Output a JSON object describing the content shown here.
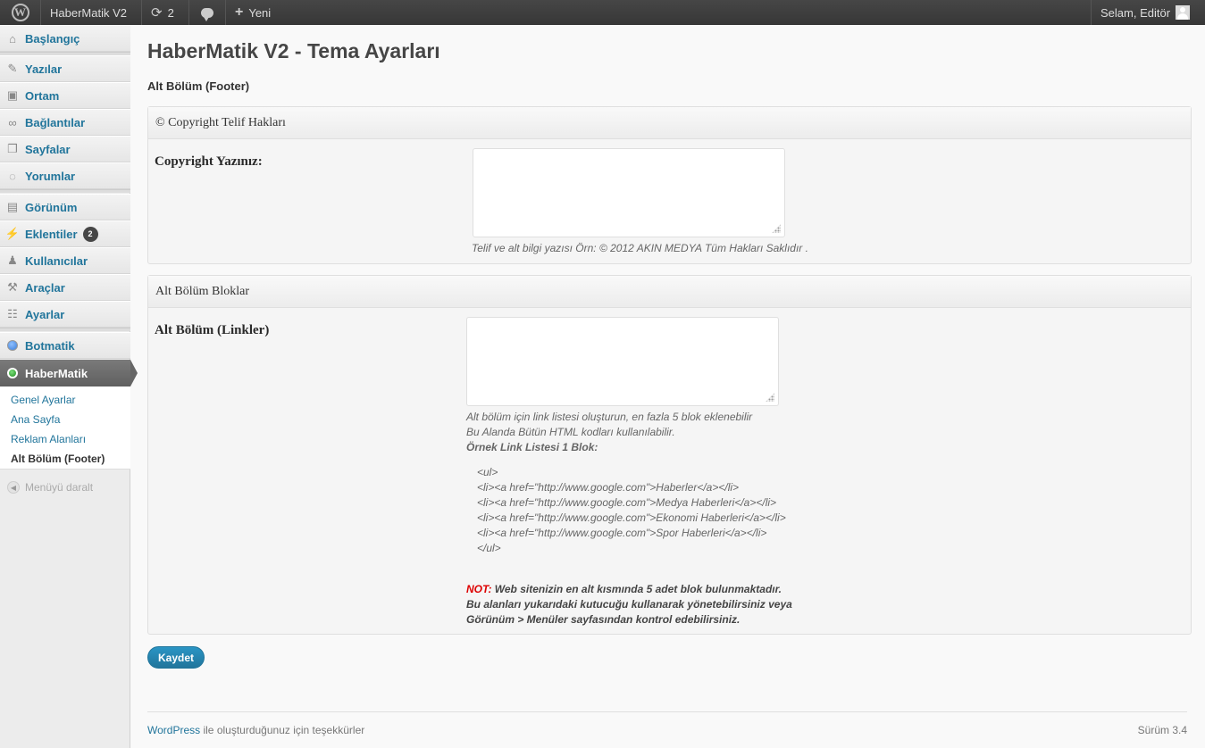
{
  "adminbar": {
    "site_name": "HaberMatik V2",
    "updates_count": "2",
    "new_label": "Yeni",
    "greeting": "Selam, Editör"
  },
  "sidebar": {
    "items": [
      {
        "label": "Başlangıç",
        "icon": "home-icon"
      },
      {
        "label": "Yazılar",
        "icon": "pin-icon"
      },
      {
        "label": "Ortam",
        "icon": "media-icon"
      },
      {
        "label": "Bağlantılar",
        "icon": "link-icon"
      },
      {
        "label": "Sayfalar",
        "icon": "pages-icon"
      },
      {
        "label": "Yorumlar",
        "icon": "comment-icon"
      },
      {
        "label": "Görünüm",
        "icon": "appearance-icon"
      },
      {
        "label": "Eklentiler",
        "icon": "plugin-icon",
        "badge": "2"
      },
      {
        "label": "Kullanıcılar",
        "icon": "users-icon"
      },
      {
        "label": "Araçlar",
        "icon": "tools-icon"
      },
      {
        "label": "Ayarlar",
        "icon": "settings-icon"
      },
      {
        "label": "Botmatik",
        "icon": "circle-icon"
      },
      {
        "label": "HaberMatik",
        "icon": "circle-icon",
        "active": true
      }
    ],
    "submenu": [
      "Genel Ayarlar",
      "Ana Sayfa",
      "Reklam Alanları",
      "Alt Bölüm (Footer)"
    ],
    "collapse_label": "Menüyü daralt"
  },
  "main": {
    "title": "HaberMatik V2 - Tema Ayarları",
    "section_heading": "Alt Bölüm (Footer)",
    "box1": {
      "title": "© Copyright Telif Hakları",
      "field_label": "Copyright Yazınız:",
      "description": "Telif ve alt bilgi yazısı Örn: © 2012 AKIN MEDYA Tüm Hakları Saklıdır ."
    },
    "box2": {
      "title": "Alt Bölüm Bloklar",
      "field_label": "Alt Bölüm (Linkler)",
      "desc_line1": "Alt bölüm için link listesi oluşturun, en fazla 5 blok eklenebilir",
      "desc_line2": "Bu Alanda Bütün HTML kodları kullanılabilir.",
      "example_heading": "Örnek Link Listesi 1 Blok:",
      "code_lines": [
        "<ul>",
        "<li><a href=\"http://www.google.com\">Haberler</a></li>",
        "<li><a href=\"http://www.google.com\">Medya Haberleri</a></li>",
        "<li><a href=\"http://www.google.com\">Ekonomi Haberleri</a></li>",
        "<li><a href=\"http://www.google.com\">Spor Haberleri</a></li>",
        "</ul>"
      ],
      "note_prefix": "NOT:",
      "note_line1": " Web sitenizin en alt kısmında 5 adet blok bulunmaktadır.",
      "note_line2": "Bu alanları yukarıdaki kutucuğu kullanarak yönetebilirsiniz veya",
      "note_line3": "Görünüm > Menüler sayfasından kontrol edebilirsiniz."
    },
    "save_label": "Kaydet"
  },
  "footer": {
    "wordpress_link": "WordPress",
    "thanks_text": " ile oluşturduğunuz için teşekkürler",
    "version": "Sürüm 3.4"
  },
  "colors": {
    "link": "#21759b",
    "botmatik_dot": "#3b7dd8",
    "habermatik_dot": "#2a9d2a"
  }
}
